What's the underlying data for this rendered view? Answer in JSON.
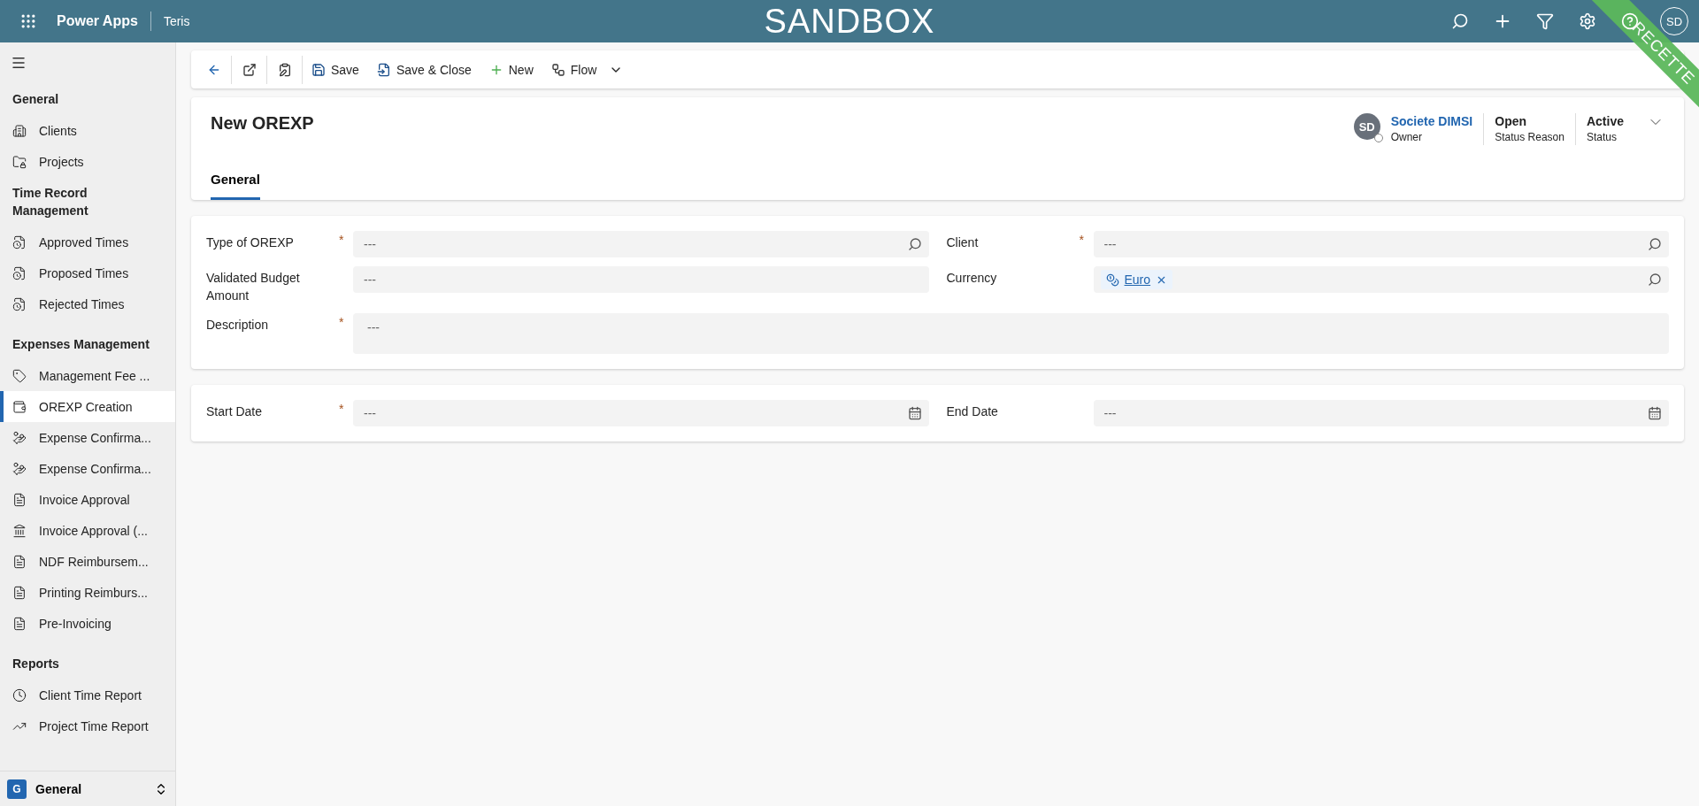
{
  "topbar": {
    "app": "Power Apps",
    "environment": "Teris",
    "banner": "SANDBOX",
    "avatar": "SD",
    "ribbon": "RECETTE"
  },
  "sidebar": {
    "groups": [
      {
        "title": "General",
        "items": [
          {
            "label": "Clients",
            "selected": false
          },
          {
            "label": "Projects",
            "selected": false
          }
        ]
      },
      {
        "title": "Time Record Management",
        "items": [
          {
            "label": "Approved Times",
            "selected": false
          },
          {
            "label": "Proposed Times",
            "selected": false
          },
          {
            "label": "Rejected Times",
            "selected": false
          }
        ]
      },
      {
        "title": "Expenses Management",
        "items": [
          {
            "label": "Management Fee ...",
            "selected": false
          },
          {
            "label": "OREXP Creation",
            "selected": true
          },
          {
            "label": "Expense Confirma...",
            "selected": false
          },
          {
            "label": "Expense Confirma...",
            "selected": false
          },
          {
            "label": "Invoice Approval",
            "selected": false
          },
          {
            "label": "Invoice Approval (...",
            "selected": false
          },
          {
            "label": "NDF Reimbursem...",
            "selected": false
          },
          {
            "label": "Printing Reimburs...",
            "selected": false
          },
          {
            "label": "Pre-Invoicing",
            "selected": false
          }
        ]
      },
      {
        "title": "Reports",
        "items": [
          {
            "label": "Client Time Report",
            "selected": false
          },
          {
            "label": "Project Time Report",
            "selected": false
          }
        ]
      }
    ],
    "area": {
      "initial": "G",
      "label": "General"
    }
  },
  "commands": [
    {
      "label": "Save",
      "has_menu": false
    },
    {
      "label": "Save & Close",
      "has_menu": false
    },
    {
      "label": "New",
      "has_menu": false
    },
    {
      "label": "Flow",
      "has_menu": true
    }
  ],
  "header": {
    "title": "New OREXP",
    "owner": {
      "initials": "SD",
      "name": "Societe DIMSI",
      "label": "Owner"
    },
    "fields": [
      {
        "value": "Open",
        "label": "Status Reason"
      },
      {
        "value": "Active",
        "label": "Status"
      }
    ],
    "tabs": [
      {
        "label": "General",
        "selected": true
      }
    ]
  },
  "sections": [
    {
      "fields": [
        {
          "label": "Type of OREXP",
          "required_mark": "*",
          "kind": "lookup",
          "value": "---"
        },
        {
          "label": "Client",
          "required_mark": "*",
          "kind": "lookup",
          "value": "---"
        },
        {
          "label": "Validated Budget Amount",
          "kind": "text",
          "value": "---"
        },
        {
          "label": "Currency",
          "kind": "lookup",
          "tag": "Euro"
        },
        {
          "label": "Description",
          "required_mark": "*",
          "kind": "multiline",
          "value": "---"
        }
      ]
    },
    {
      "fields": [
        {
          "label": "Start Date",
          "required_mark": "*",
          "kind": "date",
          "value": "---"
        },
        {
          "label": "End Date",
          "kind": "date",
          "value": "---"
        }
      ]
    }
  ]
}
